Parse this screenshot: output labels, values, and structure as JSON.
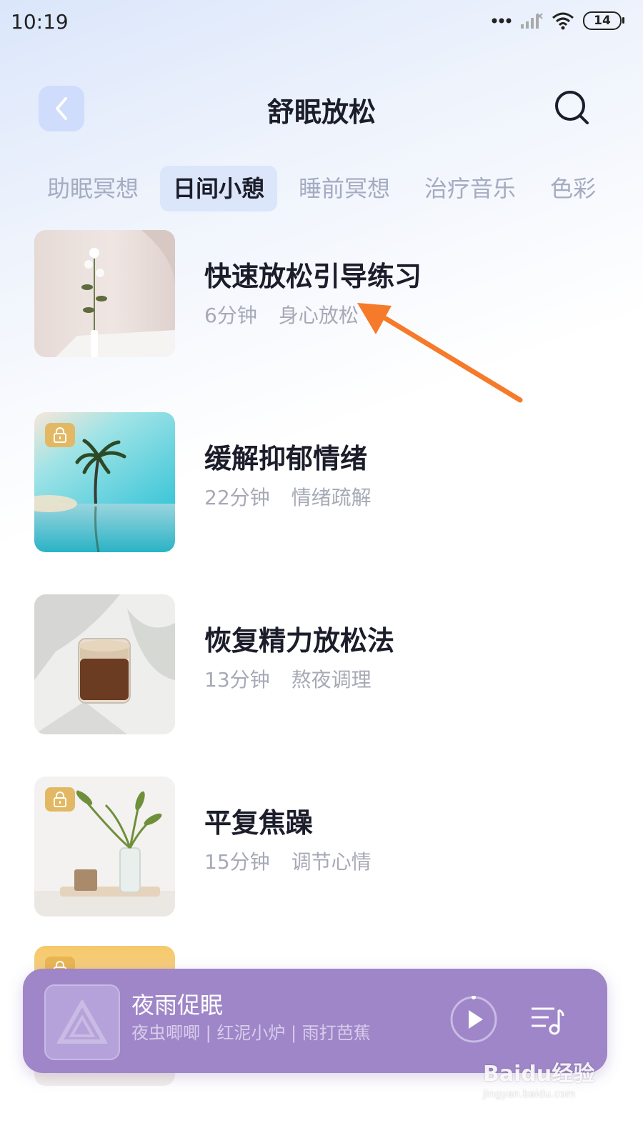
{
  "status_bar": {
    "time": "10:19",
    "battery": "14"
  },
  "header": {
    "title": "舒眠放松"
  },
  "tabs": [
    {
      "label": "助眠冥想"
    },
    {
      "label": "日间小憩"
    },
    {
      "label": "睡前冥想"
    },
    {
      "label": "治疗音乐"
    },
    {
      "label": "色彩"
    }
  ],
  "items": [
    {
      "title": "快速放松引导练习",
      "duration": "6分钟",
      "tag": "身心放松",
      "locked": false
    },
    {
      "title": "缓解抑郁情绪",
      "duration": "22分钟",
      "tag": "情绪疏解",
      "locked": true
    },
    {
      "title": "恢复精力放松法",
      "duration": "13分钟",
      "tag": "熬夜调理",
      "locked": false
    },
    {
      "title": "平复焦躁",
      "duration": "15分钟",
      "tag": "调节心情",
      "locked": true
    }
  ],
  "player": {
    "title": "夜雨促眠",
    "subtitle": "夜虫唧唧 | 红泥小炉 | 雨打芭蕉"
  },
  "watermark": {
    "text": "Baidu经验",
    "url": "jingyan.baidu.com"
  },
  "colors": {
    "accent_tab_bg": "#dbe6fb",
    "player_bg": "#9f86c8",
    "arrow": "#f57a2a",
    "lock_badge": "#e3b864"
  }
}
